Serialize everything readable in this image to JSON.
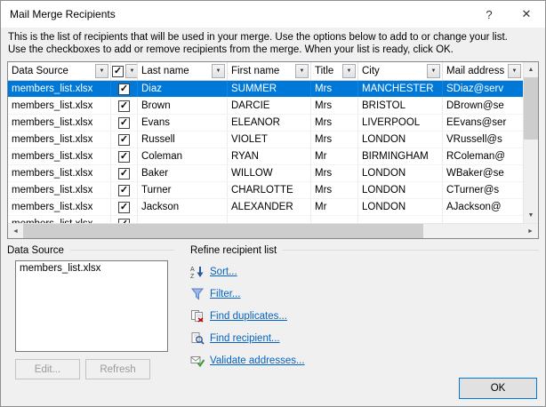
{
  "window": {
    "title": "Mail Merge Recipients",
    "help": "?",
    "close": "✕"
  },
  "description": {
    "line1": "This is the list of recipients that will be used in your merge.  Use the options below to add to or change your list.",
    "line2": "Use the checkboxes to add or remove recipients from the merge.  When your list is ready, click OK."
  },
  "icons": {
    "dropdown": "▼",
    "check": "✓",
    "scroll_up": "▲",
    "scroll_down": "▼",
    "scroll_left": "◄",
    "scroll_right": "►"
  },
  "grid": {
    "columns": [
      "Data Source",
      "",
      "Last name",
      "First name",
      "Title",
      "City",
      "Mail address"
    ],
    "rows": [
      {
        "source": "members_list.xlsx",
        "checked": true,
        "last": "Diaz",
        "first": "SUMMER",
        "title": "Mrs",
        "city": "MANCHESTER",
        "email": "SDiaz@serv",
        "selected": true
      },
      {
        "source": "members_list.xlsx",
        "checked": true,
        "last": "Brown",
        "first": "DARCIE",
        "title": "Mrs",
        "city": "BRISTOL",
        "email": "DBrown@se",
        "selected": false
      },
      {
        "source": "members_list.xlsx",
        "checked": true,
        "last": "Evans",
        "first": "ELEANOR",
        "title": "Mrs",
        "city": "LIVERPOOL",
        "email": "EEvans@ser",
        "selected": false
      },
      {
        "source": "members_list.xlsx",
        "checked": true,
        "last": "Russell",
        "first": "VIOLET",
        "title": "Mrs",
        "city": "LONDON",
        "email": "VRussell@s",
        "selected": false
      },
      {
        "source": "members_list.xlsx",
        "checked": true,
        "last": "Coleman",
        "first": "RYAN",
        "title": "Mr",
        "city": "BIRMINGHAM",
        "email": "RColeman@",
        "selected": false
      },
      {
        "source": "members_list.xlsx",
        "checked": true,
        "last": "Baker",
        "first": "WILLOW",
        "title": "Mrs",
        "city": "LONDON",
        "email": "WBaker@se",
        "selected": false
      },
      {
        "source": "members_list.xlsx",
        "checked": true,
        "last": "Turner",
        "first": "CHARLOTTE",
        "title": "Mrs",
        "city": "LONDON",
        "email": "CTurner@s",
        "selected": false
      },
      {
        "source": "members_list.xlsx",
        "checked": true,
        "last": "Jackson",
        "first": "ALEXANDER",
        "title": "Mr",
        "city": "LONDON",
        "email": "AJackson@",
        "selected": false
      },
      {
        "source": "members_list.xlsx",
        "checked": true,
        "last": "",
        "first": "",
        "title": "",
        "city": "",
        "email": "",
        "selected": false
      }
    ]
  },
  "data_source_panel": {
    "label": "Data Source",
    "items": [
      "members_list.xlsx"
    ],
    "edit": "Edit...",
    "refresh": "Refresh"
  },
  "refine_panel": {
    "label": "Refine recipient list",
    "links": [
      "Sort...",
      "Filter...",
      "Find duplicates...",
      "Find recipient...",
      "Validate addresses..."
    ]
  },
  "footer": {
    "ok": "OK"
  }
}
